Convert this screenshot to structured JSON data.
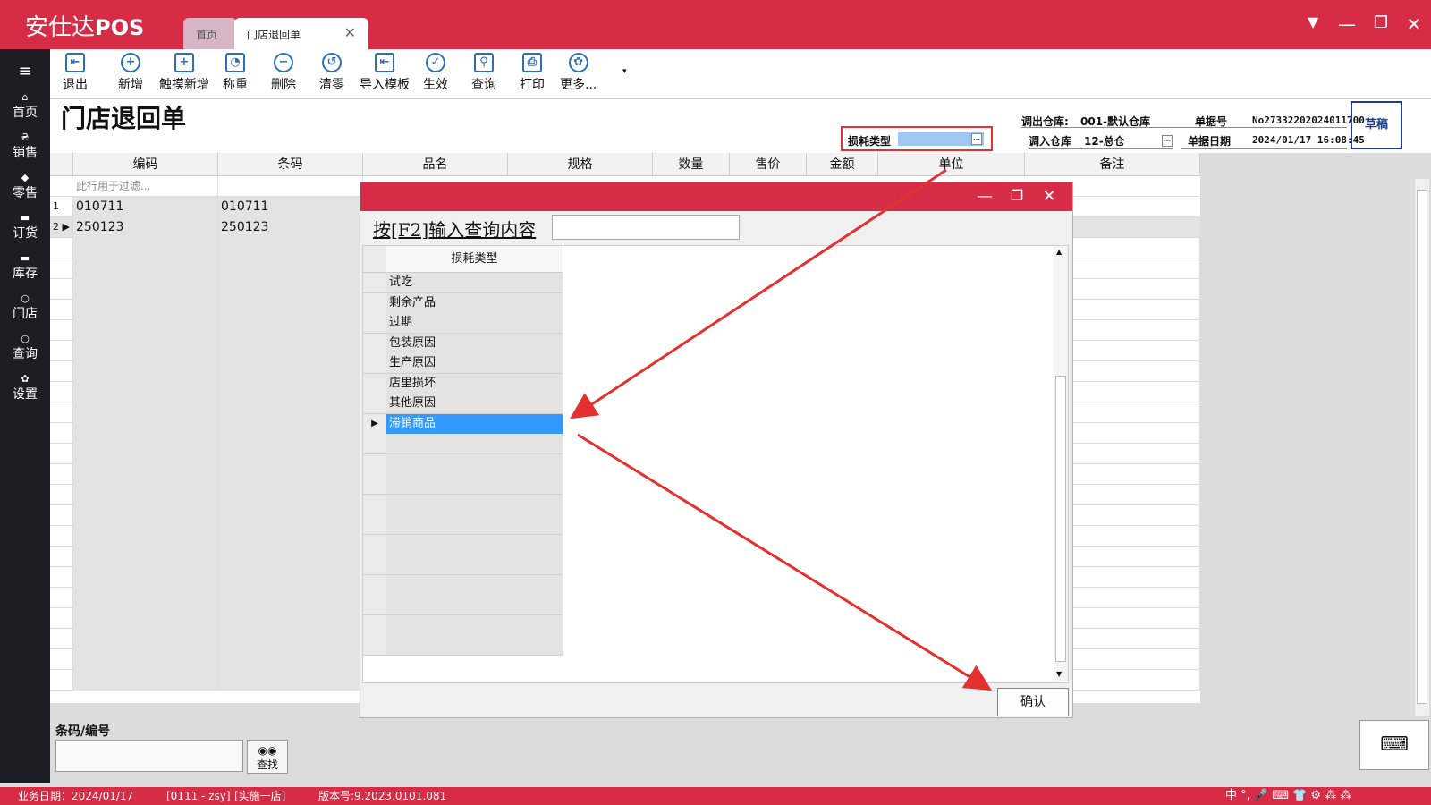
{
  "app": {
    "logo_cn": "安仕达",
    "logo_en": "POS",
    "tabs": [
      {
        "label": "首页"
      },
      {
        "label": "门店退回单"
      }
    ],
    "window_buttons": [
      "▼",
      "—",
      "❐",
      "✕"
    ]
  },
  "leftnav": {
    "menu_icon": "≡",
    "items": [
      {
        "label": "首页",
        "icon": "home-icon"
      },
      {
        "label": "销售",
        "icon": "currency-icon"
      },
      {
        "label": "零售",
        "icon": "tag-icon"
      },
      {
        "label": "订货",
        "icon": "box-icon"
      },
      {
        "label": "库存",
        "icon": "box-icon"
      },
      {
        "label": "门店",
        "icon": "search-icon"
      },
      {
        "label": "查询",
        "icon": "search-icon"
      },
      {
        "label": "设置",
        "icon": "gear-icon"
      }
    ]
  },
  "toolbar": {
    "buttons": [
      {
        "label": "退出",
        "icon": "exit-icon"
      },
      {
        "label": "新增",
        "icon": "plus-icon"
      },
      {
        "label": "触摸新增",
        "icon": "doc-add-icon"
      },
      {
        "label": "称重",
        "icon": "scale-icon"
      },
      {
        "label": "删除",
        "icon": "minus-icon"
      },
      {
        "label": "清零",
        "icon": "undo-icon"
      },
      {
        "label": "导入模板",
        "icon": "import-icon"
      },
      {
        "label": "生效",
        "icon": "check-icon"
      },
      {
        "label": "查询",
        "icon": "magnifier-icon"
      },
      {
        "label": "打印",
        "icon": "printer-icon"
      },
      {
        "label": "更多...",
        "icon": "gear-icon"
      }
    ]
  },
  "header": {
    "title": "门店退回单",
    "loss_type_label": "损耗类型",
    "out_warehouse_label": "调出仓库:",
    "out_warehouse_value": "001-默认仓库",
    "in_warehouse_label": "调入仓库",
    "in_warehouse_value": "12-总仓",
    "doc_no_label": "单据号",
    "doc_no_value": "No27332202024011700",
    "doc_date_label": "单据日期",
    "doc_date_value": "2024/01/17 16:08:45",
    "status": "草稿"
  },
  "grid": {
    "columns": [
      "编码",
      "条码",
      "品名",
      "规格",
      "数量",
      "售价",
      "金额",
      "单位",
      "备注"
    ],
    "filter_placeholder": "此行用于过滤...",
    "rows": [
      {
        "no": "1",
        "code": "010711",
        "barcode": "010711"
      },
      {
        "no": "2",
        "code": "250123",
        "barcode": "250123"
      }
    ]
  },
  "dialog": {
    "window_buttons": [
      "—",
      "❐",
      "✕"
    ],
    "search_label": "按[F2]输入查询内容",
    "search_value": "",
    "column_header": "损耗类型",
    "items": [
      "试吃",
      "剩余产品",
      "过期",
      "包装原因",
      "生产原因",
      "店里损坏",
      "其他原因",
      "滞销商品"
    ],
    "selected_index": 7,
    "confirm_label": "确认"
  },
  "bottom": {
    "barcode_label": "条码/编号",
    "barcode_value": "",
    "find_label": "查找",
    "keyboard_icon": "⌨"
  },
  "statusbar": {
    "business_date": "业务日期：2024/01/17",
    "user": "[0111 - zsy]",
    "store": "[实施一店]",
    "version": "版本号:9.2023.0101.081",
    "ime_text": "中 °, 🎤 ⌨ 👕 ⚙ ⁂ ⁂"
  },
  "colors": {
    "brand": "#d62c46",
    "nav_bg": "#1d1d24",
    "selection": "#3399ff",
    "annotation": "#e53030"
  }
}
